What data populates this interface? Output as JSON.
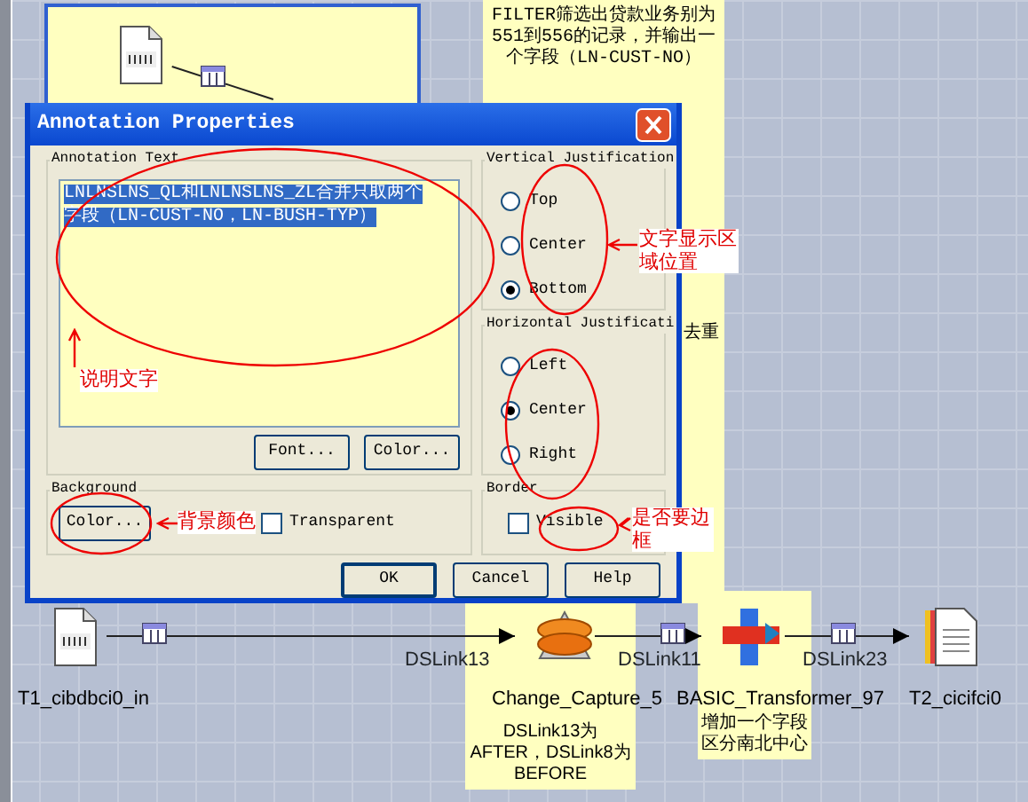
{
  "canvas": {
    "notes": [
      {
        "text": "FILTER筛选出贷款业务别为551到556的记录，并输出一个字段（LN-CUST-NO）"
      },
      {
        "text": "去重"
      },
      {
        "text": "DSLink13为AFTER，DSLink8为BEFORE"
      },
      {
        "text": "增加一个字段区分南北中心"
      }
    ],
    "stages": [
      {
        "kind": "source",
        "label": "T1_cibdbci0_in"
      },
      {
        "kind": "capture",
        "label": "Change_Capture_5"
      },
      {
        "kind": "transformer",
        "label": "BASIC_Transformer_97"
      },
      {
        "kind": "target",
        "label": "T2_cicifci0"
      }
    ],
    "links": [
      {
        "label": "DSLink13"
      },
      {
        "label": "DSLink11"
      },
      {
        "label": "DSLink23"
      }
    ]
  },
  "dialog": {
    "title": "Annotation Properties",
    "annotation_text": {
      "legend": "Annotation Text",
      "value": "LNLNSLNS_QL和LNLNSLNS_ZL合并只取两个字段（LN-CUST-NO，LN-BUSH-TYP）",
      "text_selected": true,
      "buttons": [
        "Font...",
        "Color..."
      ]
    },
    "vertical": {
      "legend": "Vertical Justification",
      "options": [
        {
          "label": "Top",
          "selected": false
        },
        {
          "label": "Center",
          "selected": false
        },
        {
          "label": "Bottom",
          "selected": true
        }
      ]
    },
    "horizontal": {
      "legend": "Horizontal Justificati",
      "options": [
        {
          "label": "Left",
          "selected": false
        },
        {
          "label": "Center",
          "selected": true
        },
        {
          "label": "Right",
          "selected": false
        }
      ]
    },
    "background": {
      "legend": "Background",
      "button": "Color...",
      "transparent": {
        "label": "Transparent",
        "checked": false
      }
    },
    "border": {
      "legend": "Border",
      "visible": {
        "label": "Visible",
        "checked": false
      }
    },
    "buttons": [
      "OK",
      "Cancel",
      "Help"
    ]
  },
  "annotations": [
    {
      "text": "说明文字"
    },
    {
      "text": "文字显示区域位置"
    },
    {
      "text": "背景颜色"
    },
    {
      "text": "是否要边框"
    }
  ]
}
